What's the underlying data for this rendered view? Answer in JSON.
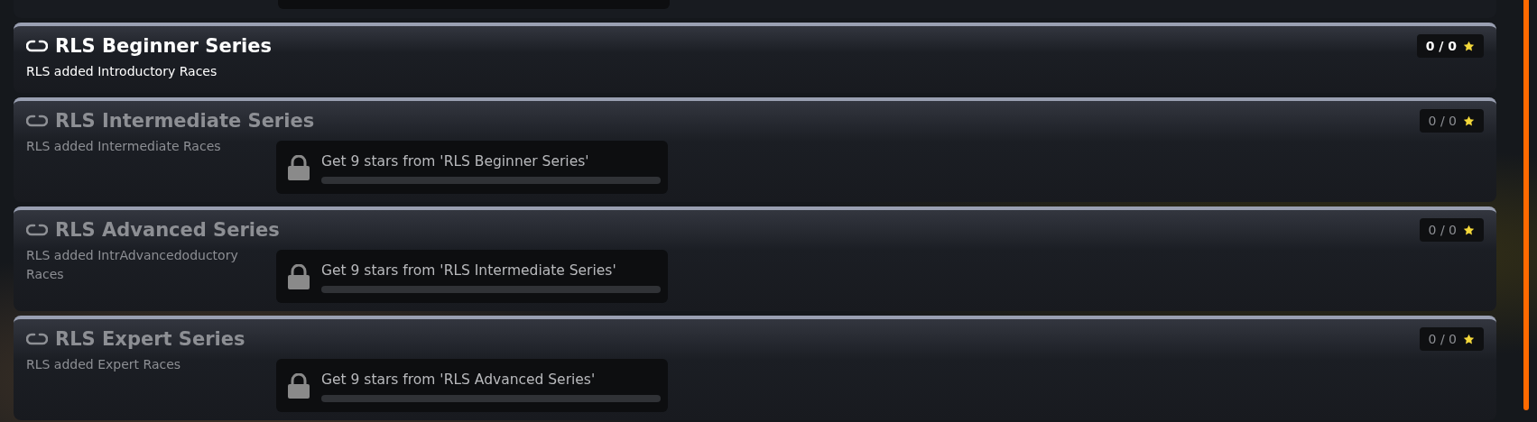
{
  "series": [
    {
      "title": "RLS Beginner Series",
      "description": "RLS added Introductory Races",
      "stars": "0 / 0",
      "locked": false
    },
    {
      "title": "RLS Intermediate Series",
      "description": "RLS added Intermediate Races",
      "stars": "0 / 0",
      "locked": true,
      "requirement": {
        "text": "Get 9 stars from 'RLS Beginner Series'",
        "level": 0
      }
    },
    {
      "title": "RLS Advanced Series",
      "description": "RLS added IntrAdvancedoductory Races",
      "stars": "0 / 0",
      "locked": true,
      "requirement": {
        "text": "Get 9 stars from 'RLS Intermediate Series'",
        "level": 0
      }
    },
    {
      "title": "RLS Expert Series",
      "description": "RLS added Expert Races",
      "stars": "0 / 0",
      "locked": true,
      "requirement": {
        "text": "Get 9 stars from 'RLS Advanced Series'",
        "level": 0
      }
    }
  ]
}
